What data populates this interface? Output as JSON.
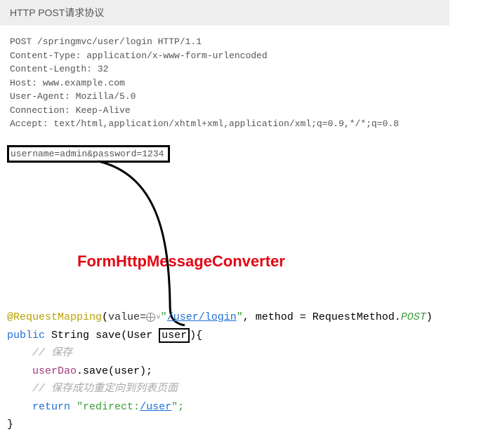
{
  "header": {
    "title": "HTTP POST请求协议"
  },
  "http": {
    "request_line": "POST /springmvc/user/login HTTP/1.1",
    "headers": [
      "Content-Type: application/x-www-form-urlencoded",
      "Content-Length: 32",
      "Host: www.example.com",
      "User-Agent: Mozilla/5.0",
      "Connection: Keep-Alive",
      "Accept: text/html,application/xhtml+xml,application/xml;q=0.9,*/*;q=0.8"
    ],
    "body": "username=admin&password=1234"
  },
  "converter_label": "FormHttpMessageConverter",
  "code": {
    "annotation": "@RequestMapping",
    "value_key": "value=",
    "url": "/user/login",
    "url_quoted_prefix": "\"",
    "url_quoted_suffix": "\"",
    "method_part": ", method = RequestMethod.",
    "method_enum": "POST",
    "close_paren": ")",
    "public": "public",
    "return_type": "String",
    "method_name": "save",
    "param_type": "User",
    "param_name": "user",
    "method_open": "){",
    "comment1": "// 保存",
    "dao": "userDao",
    "save_call": ".save(user);",
    "comment2": "// 保存成功重定向到列表页面",
    "return_kw": "return",
    "return_prefix": "\"redirect:",
    "return_link": "/user",
    "return_suffix": "\";",
    "close_brace": "}"
  }
}
